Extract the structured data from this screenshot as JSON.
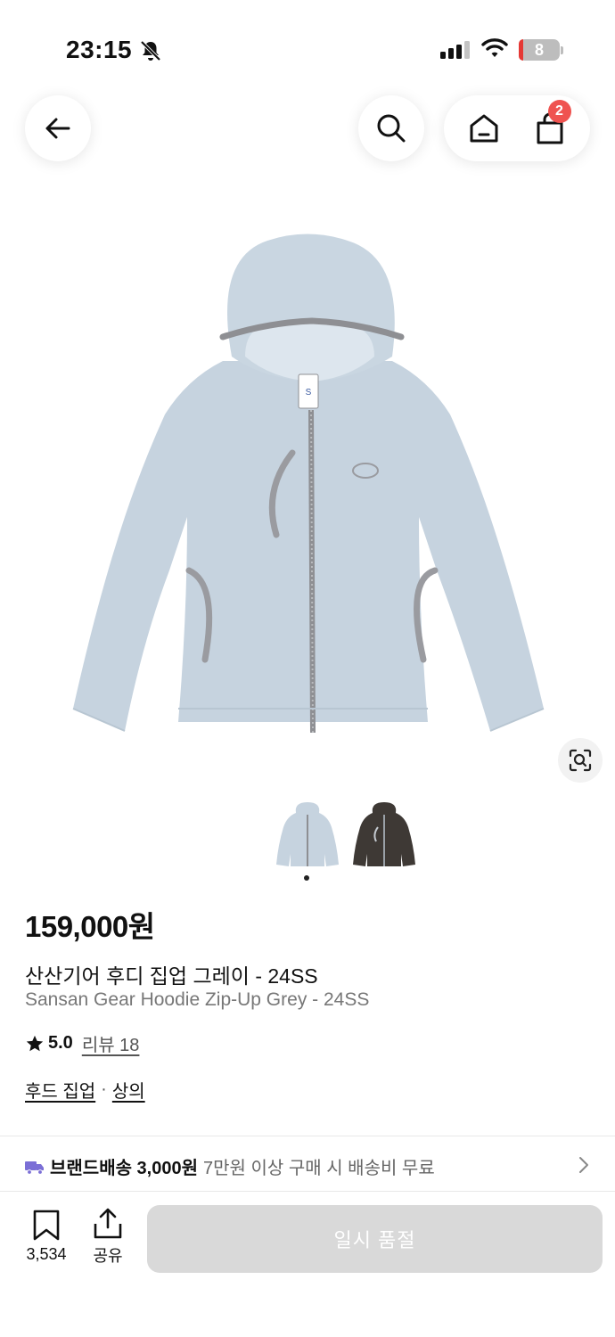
{
  "status_bar": {
    "time": "23:15",
    "battery": "8"
  },
  "nav": {
    "cart_count": "2"
  },
  "product": {
    "price": "159,000원",
    "name_ko": "산산기어 후디 집업 그레이 - 24SS",
    "name_en": "Sansan Gear Hoodie Zip-Up Grey - 24SS",
    "rating": "5.0",
    "review_label": "리뷰 18",
    "categories": [
      "후드 집업",
      "상의"
    ],
    "category_sep": "·"
  },
  "shipping": {
    "label": "브랜드배송 3,000원",
    "note": "7만원 이상 구매 시 배송비 무료"
  },
  "bottom_bar": {
    "bookmark_count": "3,534",
    "share_label": "공유",
    "soldout_label": "일시 품절"
  },
  "colors": {
    "hoodie_body": "#c6d3df",
    "hoodie_trim": "#8e8f93",
    "cart_badge": "#ef5350",
    "soldout_bg": "#d9d9d9",
    "truck": "#7b6fd6"
  }
}
